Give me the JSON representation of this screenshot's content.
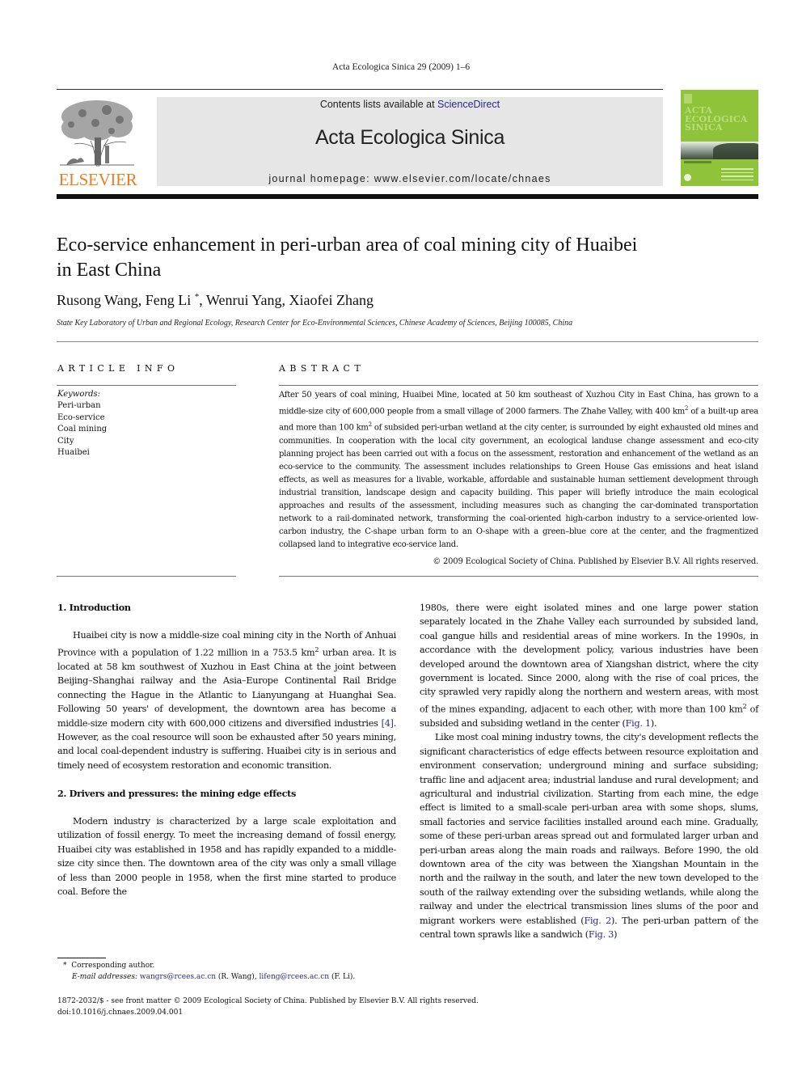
{
  "running_head": "Acta Ecologica Sinica 29 (2009) 1–6",
  "publisher_logo": {
    "text": "ELSEVIER",
    "color": "#f07c1c"
  },
  "banner": {
    "contents_prefix": "Contents lists available at ",
    "contents_link": "ScienceDirect",
    "journal_title": "Acta Ecologica Sinica",
    "homepage_label": "journal homepage: ",
    "homepage_url": "www.elsevier.com/locate/chnaes"
  },
  "cover": {
    "title_lines": [
      "ACTA",
      "ECOLOGICA",
      "SINICA"
    ],
    "background_color": "#8fc43a"
  },
  "article": {
    "title_line1": "Eco-service enhancement in peri-urban area of coal mining city of Huaibei",
    "title_line2": "in East China",
    "authors": [
      {
        "name": "Rusong Wang",
        "sep": ", "
      },
      {
        "name": "Feng Li",
        "mark": "*",
        "sep": ", "
      },
      {
        "name": "Wenrui Yang",
        "sep": ", "
      },
      {
        "name": "Xiaofei Zhang",
        "sep": ""
      }
    ],
    "affiliation": "State Key Laboratory of Urban and Regional Ecology, Research Center for Eco-Environmental Sciences, Chinese Academy of Sciences, Beijing 100085, China"
  },
  "article_info": {
    "heading": "ARTICLE INFO",
    "keywords_label": "Keywords:",
    "keywords": [
      "Peri-urban",
      "Eco-service",
      "Coal mining",
      "City",
      "Huaibei"
    ]
  },
  "abstract": {
    "heading": "ABSTRACT",
    "text_part1": "After 50 years of coal mining, Huaibei Mine, located at 50 km southeast of Xuzhou City in East China, has grown to a middle-size city of 600,000 people from a small village of 2000 farmers. The Zhahe Valley, with 400 km",
    "text_part2": " of a built-up area and more than 100 km",
    "text_part3": " of subsided peri-urban wetland at the city center, is surrounded by eight exhausted old mines and communities. In cooperation with the local city government, an ecological landuse change assessment and eco-city planning project has been carried out with a focus on the assessment, restoration and enhancement of the wetland as an eco-service to the community. The assessment includes relationships to Green House Gas emissions and heat island effects, as well as measures for a livable, workable, affordable and sustainable human settlement development through industrial transition, landscape design and capacity building. This paper will briefly introduce the main ecological approaches and results of the assessment, including measures such as changing the car-dominated transportation network to a rail-dominated network, transforming the coal-oriented high-carbon industry to a service-oriented low-carbon industry, the C-shape urban form to an O-shape with a green–blue core at the center, and the fragmentized collapsed land to integrative eco-service land.",
    "superscript": "2",
    "copyright": "© 2009 Ecological Society of China. Published by Elsevier B.V. All rights reserved."
  },
  "sections": {
    "intro_heading": "1. Introduction",
    "intro_p1_a": "Huaibei city is now a middle-size coal mining city in the North of Anhuai Province with a population of 1.22 million in a 753.5 km",
    "intro_p1_b": " urban area. It is located at 58 km southwest of Xuzhou in East China at the joint between Beijing–Shanghai railway and the Asia–Europe Continental Rail Bridge connecting the Hague in the Atlantic to Lianyungang at Huanghai Sea. Following 50 years' of development, the downtown area has become a middle-size modern city with 600,000 citizens and diversified industries ",
    "intro_p1_ref": "[4]",
    "intro_p1_c": ". However, as the coal resource will soon be exhausted after 50 years mining, and local coal-dependent industry is suffering. Huaibei city is in serious and timely need of ecosystem restoration and economic transition.",
    "sec2_heading": "2. Drivers and pressures: the mining edge effects",
    "sec2_p1": "Modern industry is characterized by a large scale exploitation and utilization of fossil energy. To meet the increasing demand of fossil energy, Huaibei city was established in 1958 and has rapidly expanded to a middle-size city since then. The downtown area of the city was only a small village of less than 2000 people in 1958, when the first mine started to produce coal. Before the",
    "right_p1_a": "1980s, there were eight isolated mines and one large power station separately located in the Zhahe Valley each surrounded by subsided land, coal gangue hills and residential areas of mine workers. In the 1990s, in accordance with the development policy, various industries have been developed around the downtown area of Xiangshan district, where the city government is located. Since 2000, along with the rise of coal prices, the city sprawled very rapidly along the northern and western areas, with most of the mines expanding, adjacent to each other, with more than 100 km",
    "right_p1_b": " of subsided and subsiding wetland in the center (",
    "right_p1_ref": "Fig. 1",
    "right_p1_c": ").",
    "right_p2_a": "Like most coal mining industry towns, the city's development reflects the significant characteristics of edge effects between resource exploitation and environment conservation; underground mining and surface subsiding; traffic line and adjacent area; industrial landuse and rural development; and agricultural and industrial civilization. Starting from each mine, the edge effect is limited to a small-scale peri-urban area with some shops, slums, small factories and service facilities installed around each mine. Gradually, some of these peri-urban areas spread out and formulated larger urban and peri-urban areas along the main roads and railways. Before 1990, the old downtown area of the city was between the Xiangshan Mountain in the north and the railway in the south, and later the new town developed to the south of the railway extending over the subsiding wetlands, while along the railway and under the electrical transmission lines slums of the poor and migrant workers were established (",
    "right_p2_ref1": "Fig. 2",
    "right_p2_b": "). The peri-urban pattern of the central town sprawls like a sandwich (",
    "right_p2_ref2": "Fig. 3",
    "right_p2_c": ")"
  },
  "footnote": {
    "mark": "*",
    "corresponding": "Corresponding author.",
    "email_label": "E-mail addresses:",
    "email1": "wangrs@rcees.ac.cn",
    "email1_owner": " (R. Wang), ",
    "email2": "lifeng@rcees.ac.cn",
    "email2_owner": " (F. Li)."
  },
  "bottom_meta": {
    "issn_line": "1872-2032/$ - see front matter © 2009 Ecological Society of China. Published by Elsevier B.V. All rights reserved.",
    "doi": "doi:10.1016/j.chnaes.2009.04.001"
  }
}
